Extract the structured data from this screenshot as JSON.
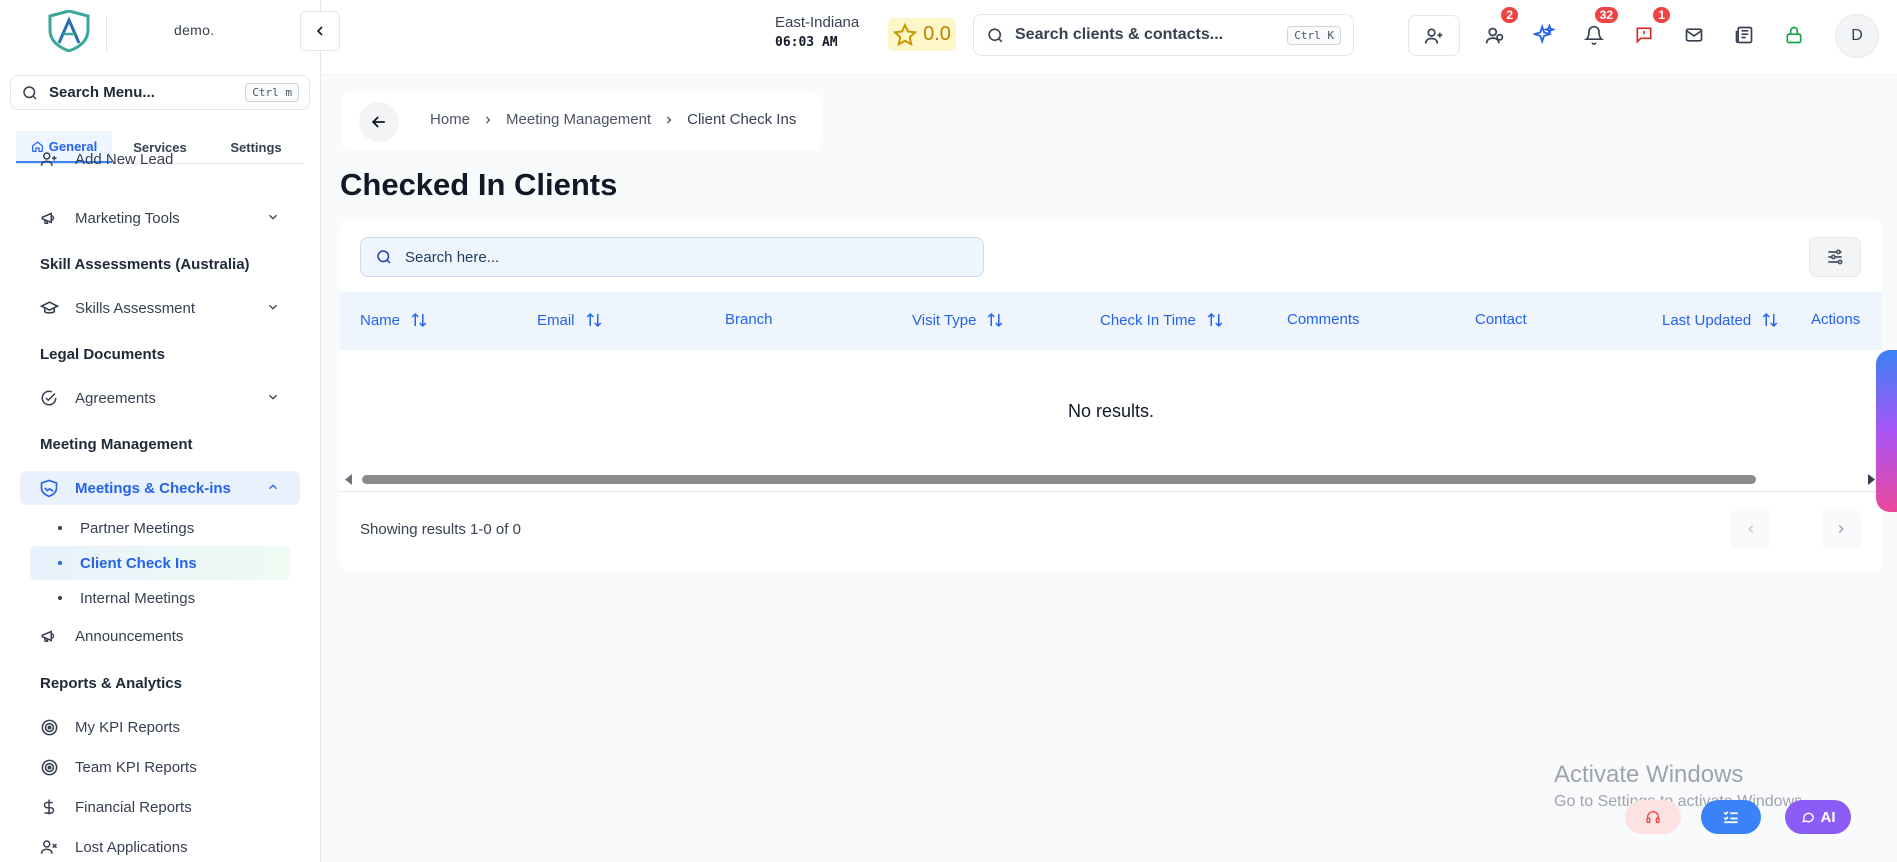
{
  "app": {
    "logo_text": "demo."
  },
  "sidebar": {
    "search": {
      "label": "Search Menu...",
      "shortcut": "Ctrl m"
    },
    "tabs": [
      {
        "label": "General",
        "active": true
      },
      {
        "label": "Services",
        "active": false
      },
      {
        "label": "Settings",
        "active": false
      }
    ],
    "items": {
      "add_new_lead": "Add New Lead",
      "marketing_tools": "Marketing Tools",
      "skills_assessment": "Skills Assessment",
      "agreements": "Agreements",
      "meetings_checkins": "Meetings & Check-ins",
      "partner_meetings": "Partner Meetings",
      "client_check_ins": "Client Check Ins",
      "internal_meetings": "Internal Meetings",
      "announcements": "Announcements",
      "my_kpi_reports": "My KPI Reports",
      "team_kpi_reports": "Team KPI Reports",
      "financial_reports": "Financial Reports",
      "lost_applications": "Lost Applications"
    },
    "sections": {
      "skill_assessments": "Skill Assessments (Australia)",
      "legal_documents": "Legal Documents",
      "meeting_management": "Meeting Management",
      "reports_analytics": "Reports & Analytics"
    }
  },
  "header": {
    "timezone": "East-Indiana",
    "time": "06:03 AM",
    "rating": "0.0",
    "search": {
      "placeholder": "Search clients & contacts...",
      "shortcut": "Ctrl K"
    },
    "badges": {
      "contacts": "2",
      "notifications": "32",
      "messages": "1"
    },
    "avatar_initial": "D"
  },
  "breadcrumb": {
    "home": "Home",
    "section": "Meeting Management",
    "current": "Client Check Ins"
  },
  "page": {
    "title": "Checked In Clients"
  },
  "table": {
    "search_placeholder": "Search here...",
    "columns": [
      {
        "label": "Name",
        "sortable": true
      },
      {
        "label": "Email",
        "sortable": true
      },
      {
        "label": "Branch",
        "sortable": false
      },
      {
        "label": "Visit Type",
        "sortable": true
      },
      {
        "label": "Check In Time",
        "sortable": true
      },
      {
        "label": "Comments",
        "sortable": false
      },
      {
        "label": "Contact",
        "sortable": false
      },
      {
        "label": "Last Updated",
        "sortable": true
      },
      {
        "label": "Actions",
        "sortable": false
      }
    ],
    "empty_text": "No results.",
    "results_text": "Showing results 1-0 of 0"
  },
  "watermark": {
    "line1": "Activate Windows",
    "line2": "Go to Settings to activate Windows."
  },
  "fab": {
    "ai_label": "AI"
  },
  "colors": {
    "accent": "#2563eb",
    "badge": "#ef4444",
    "header_bg": "#eef5fc"
  }
}
